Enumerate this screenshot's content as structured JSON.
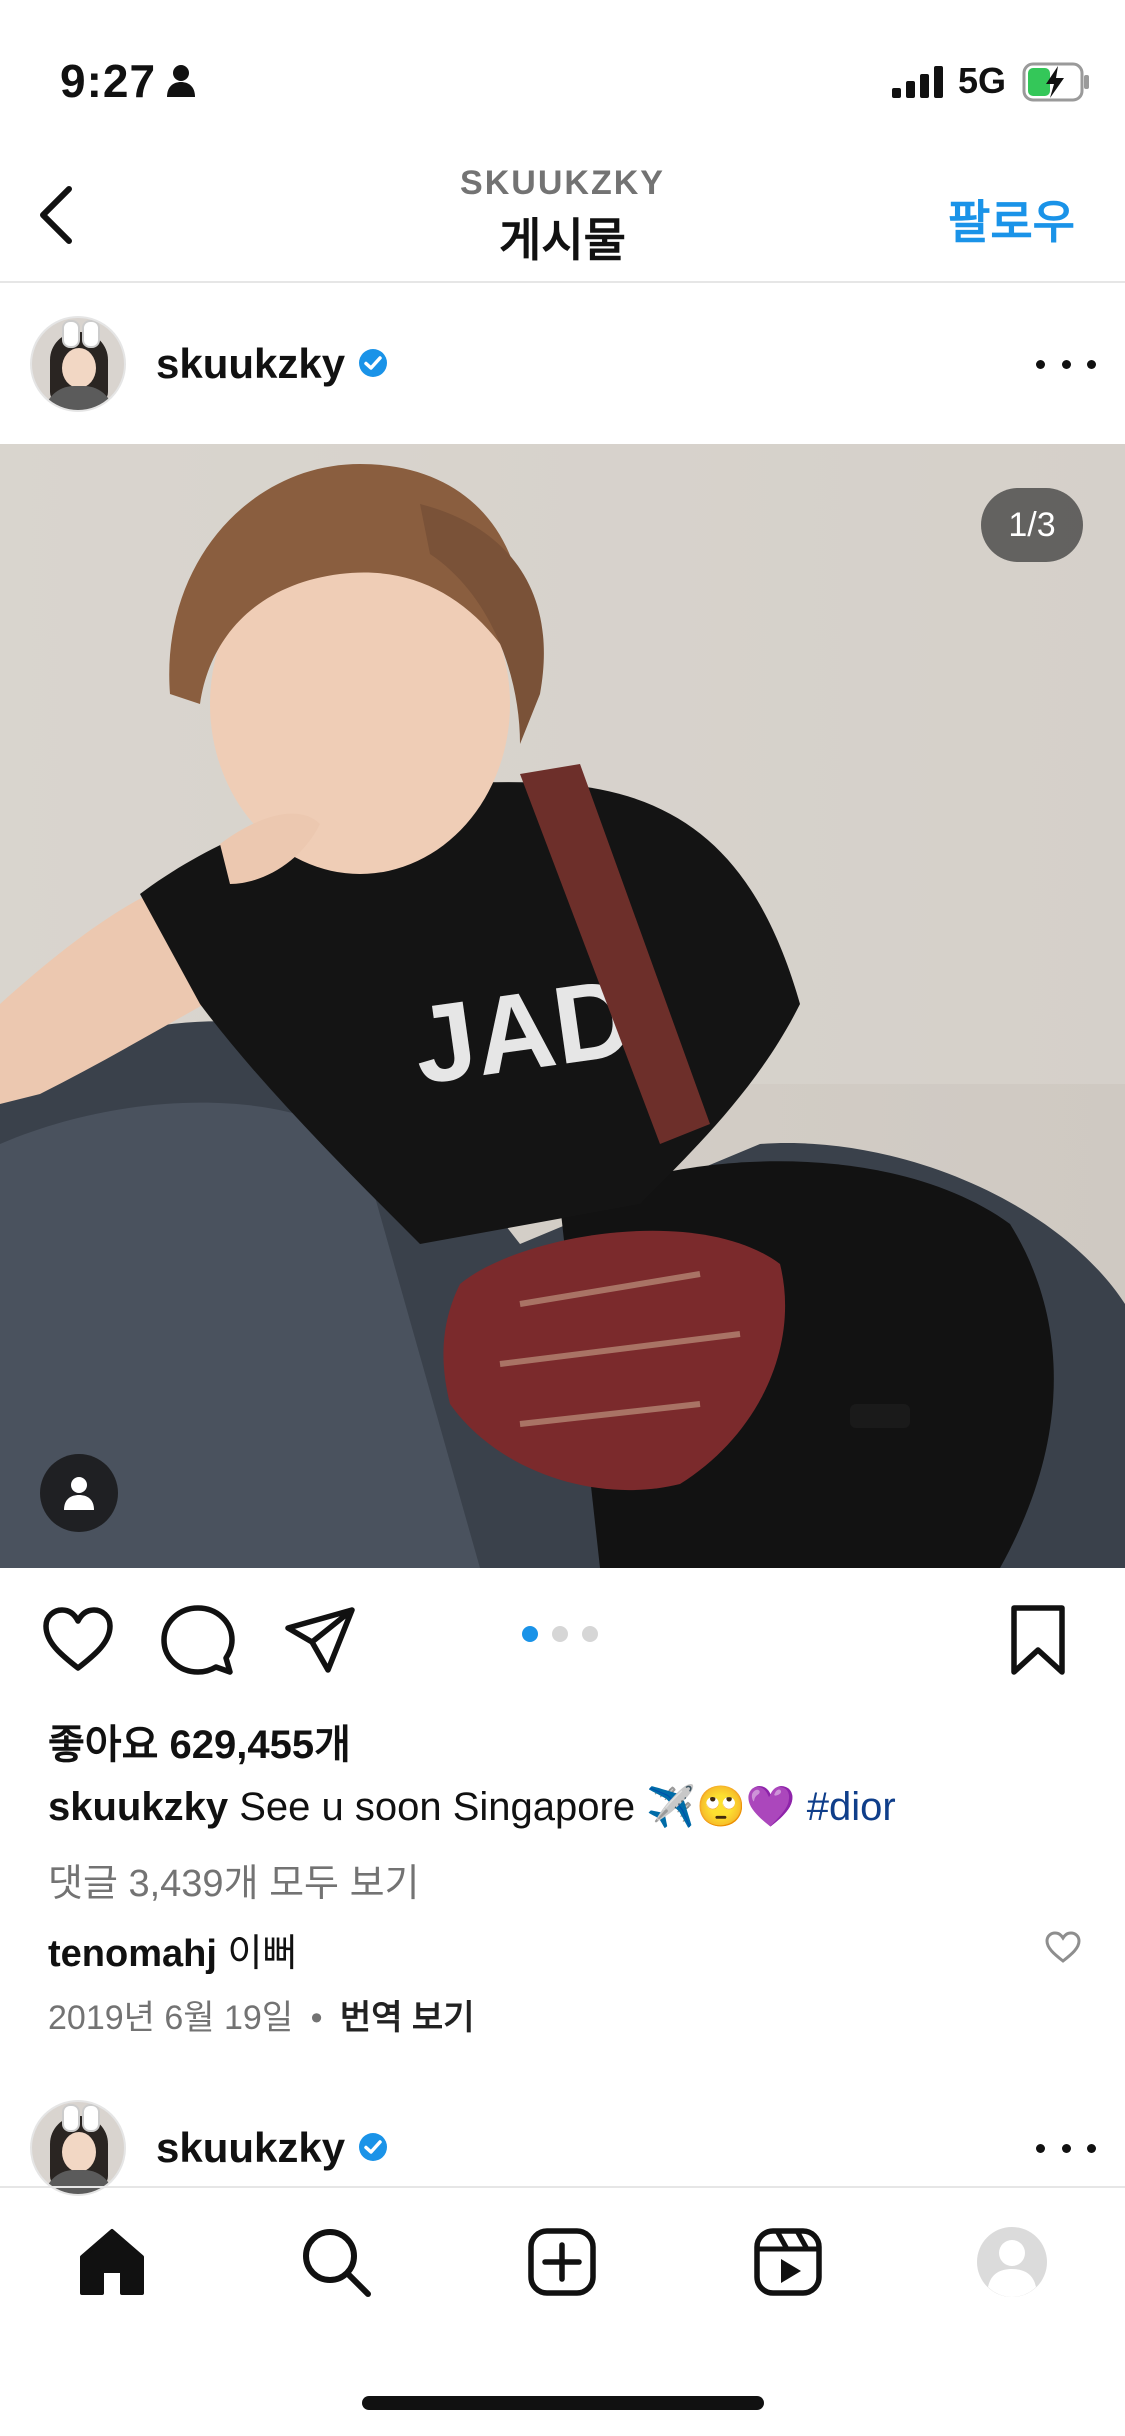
{
  "status_bar": {
    "time": "9:27",
    "network": "5G"
  },
  "header": {
    "subtitle": "SKUUKZKY",
    "title": "게시물",
    "follow_label": "팔로우"
  },
  "post": {
    "username": "skuukzky",
    "image_counter": "1/3",
    "carousel": {
      "count": 3,
      "active_index": 0
    },
    "likes_text": "좋아요 629,455개",
    "caption": {
      "username": "skuukzky",
      "text": "See u soon Singapore ✈️🙄💜",
      "hashtag": "#dior"
    },
    "view_comments": "댓글 3,439개 모두 보기",
    "top_comment": {
      "username": "tenomahj",
      "text": "이뻐"
    },
    "date": "2019년 6월 19일",
    "separator": "•",
    "translate_label": "번역 보기"
  },
  "next_post": {
    "username": "skuukzky"
  },
  "colors": {
    "accent": "#1a93e8",
    "hashtag": "#0f3e8a",
    "muted": "#737373"
  },
  "icons": {
    "status": [
      "person-icon",
      "signal-icon",
      "battery-charging-icon"
    ],
    "actions": [
      "heart-icon",
      "comment-icon",
      "share-icon",
      "bookmark-icon"
    ],
    "nav": [
      "home-icon",
      "search-icon",
      "create-icon",
      "reels-icon",
      "profile-icon"
    ]
  }
}
